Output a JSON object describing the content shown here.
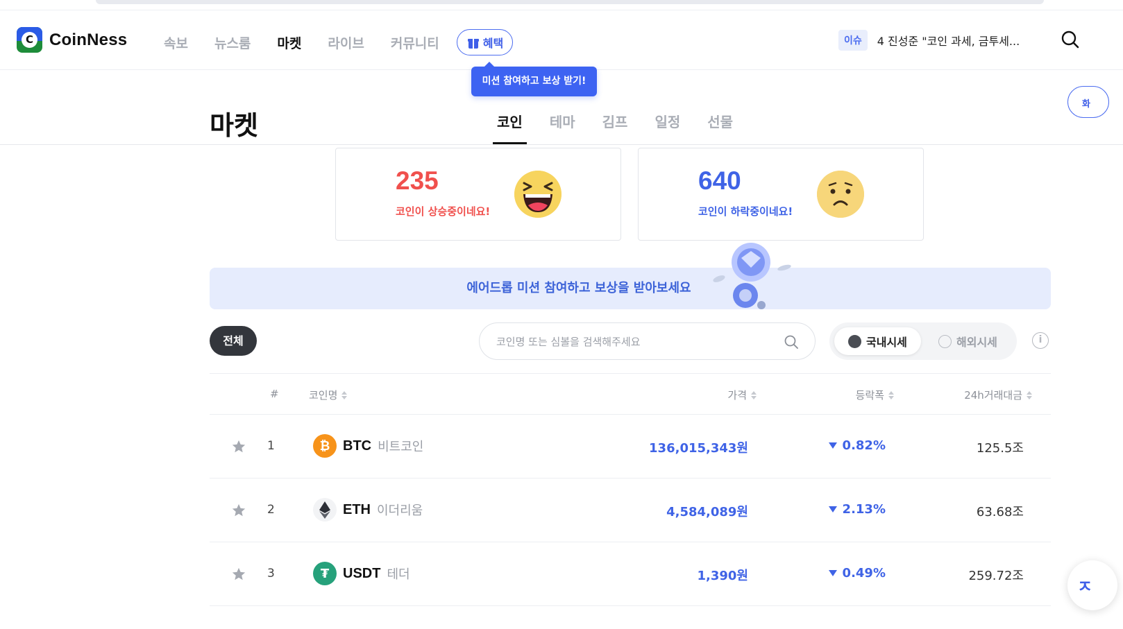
{
  "brand": {
    "name": "CoinNess"
  },
  "nav": {
    "items": [
      "속보",
      "뉴스룸",
      "마켓",
      "라이브",
      "커뮤니티"
    ],
    "active_index": 2,
    "benefit_label": "혜택"
  },
  "issue": {
    "badge": "이슈",
    "text": "4 진성준 \"코인 과세, 금투세..."
  },
  "tooltip": {
    "text": "미션 참여하고 보상 받기!"
  },
  "side": {
    "button_label": "화",
    "circle_label": "ㅈ"
  },
  "page": {
    "title": "마켓",
    "tabs": [
      "코인",
      "테마",
      "김프",
      "일정",
      "선물"
    ],
    "active_tab": 0
  },
  "stats": {
    "rising_count": "235",
    "rising_label": "코인이 상승중이네요!",
    "falling_count": "640",
    "falling_label": "코인이 하락중이네요!"
  },
  "banner": {
    "text": "에어드롭 미션 참여하고 보상을 받아보세요"
  },
  "filter": {
    "all_label": "전체",
    "search_placeholder": "코인명 또는 심볼을 검색해주세요",
    "domestic_label": "국내시세",
    "overseas_label": "해외시세",
    "info_icon": "i"
  },
  "table": {
    "headers": {
      "rank": "#",
      "name": "코인명",
      "price": "가격",
      "change": "등락폭",
      "volume": "24h거래대금"
    },
    "rows": [
      {
        "rank": "1",
        "symbol": "BTC",
        "name": "비트코인",
        "price": "136,015,343원",
        "change": "0.82%",
        "volume": "125.5조",
        "logo_color": "#f7931a",
        "logo_glyph": "₿"
      },
      {
        "rank": "2",
        "symbol": "ETH",
        "name": "이더리움",
        "price": "4,584,089원",
        "change": "2.13%",
        "volume": "63.68조",
        "logo_color": "#f2f3f5",
        "logo_glyph": "◆"
      },
      {
        "rank": "3",
        "symbol": "USDT",
        "name": "테더",
        "price": "1,390원",
        "change": "0.49%",
        "volume": "259.72조",
        "logo_color": "#26a17b",
        "logo_glyph": "₮"
      }
    ]
  },
  "colors": {
    "accent": "#3f63e6",
    "up": "#f0504d",
    "down": "#3f63e6"
  }
}
